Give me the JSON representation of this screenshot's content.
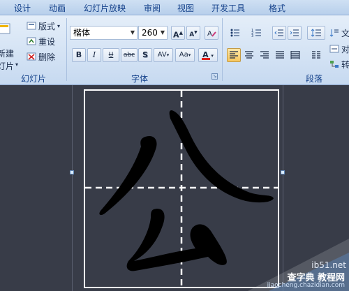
{
  "tabs": [
    "设计",
    "动画",
    "幻灯片放映",
    "审阅",
    "视图",
    "开发工具",
    "格式"
  ],
  "slides_group": {
    "new_slide_line1": "新建",
    "new_slide_line2": "灯片",
    "layout": "版式",
    "reset": "重设",
    "delete": "删除",
    "label": "幻灯片"
  },
  "font_group": {
    "font_name": "楷体",
    "font_size": "260",
    "grow_label": "A",
    "shrink_label": "A",
    "bold": "B",
    "italic": "I",
    "strike": "abc",
    "shadow": "S",
    "spacing": "AV",
    "case": "Aa",
    "color_label": "A",
    "label": "字体",
    "font_color": "#e0201b"
  },
  "paragraph_group": {
    "label": "段落",
    "text_direction": "文",
    "align_text": "对",
    "convert": "转"
  },
  "slide_content": {
    "character": "公"
  },
  "watermark": {
    "brand": "ib51.net",
    "site_name": "查字典 教程网",
    "url": "jiaocheng.chazidian.com"
  },
  "colors": {
    "ribbon_top": "#e4eef9",
    "ribbon_bottom": "#c6d9f0",
    "workspace": "#383c48",
    "tab_text": "#15428b",
    "active_align": "#f7c75e"
  }
}
